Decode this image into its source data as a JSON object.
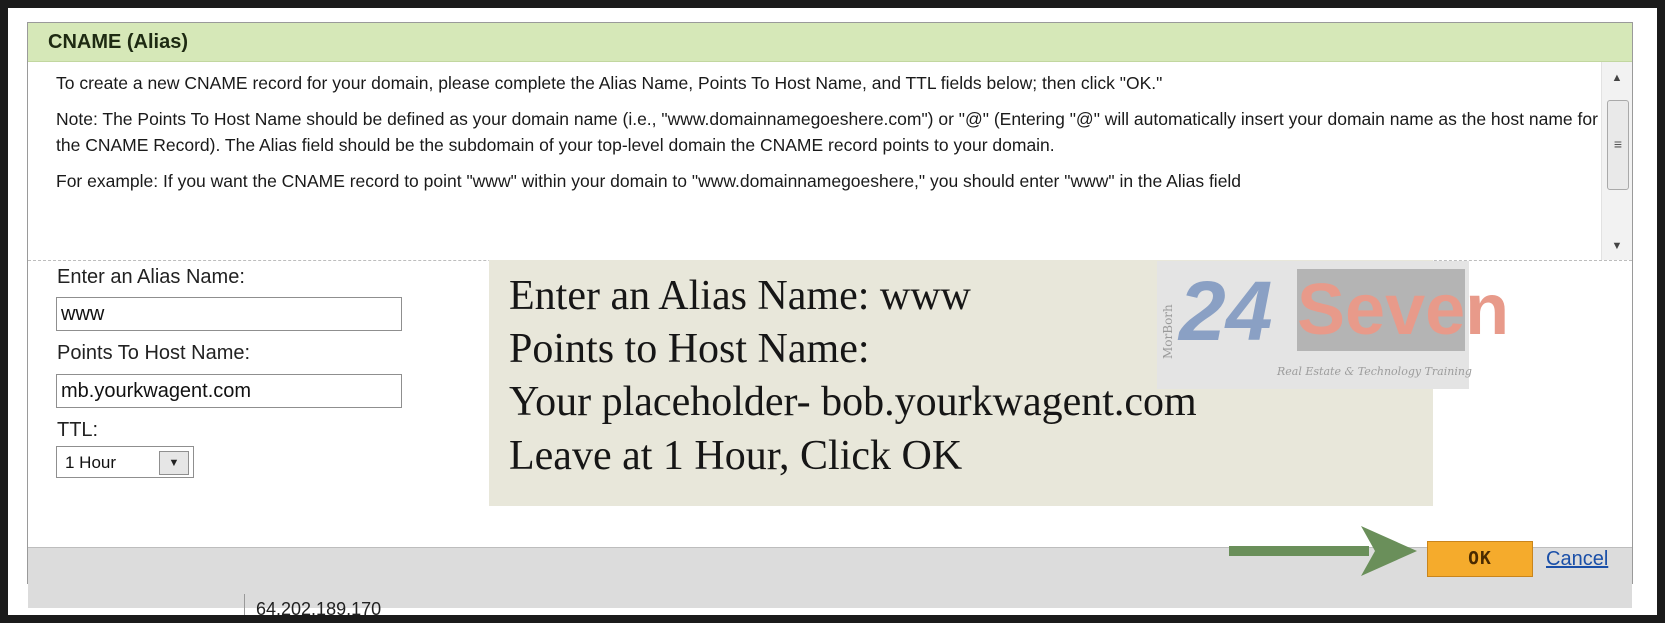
{
  "dialog": {
    "title": "CNAME (Alias)",
    "instructions": [
      "To create a new CNAME record for your domain, please complete the Alias Name, Points To Host Name, and TTL fields below; then click \"OK.\"",
      "Note: The Points To Host Name should be defined as your domain name (i.e., \"www.domainnamegoeshere.com\") or \"@\" (Entering \"@\" will automatically insert your domain name as the host name for the CNAME Record). The Alias field should be the subdomain of your top-level domain the CNAME record points to your domain.",
      "For example: If you want the CNAME record to point \"www\" within your domain to \"www.domainnamegoeshere,\" you should enter \"www\" in the Alias field"
    ],
    "form": {
      "alias_label": "Enter an Alias Name:",
      "alias_value": "www",
      "host_label": "Points To Host Name:",
      "host_value": "mb.yourkwagent.com",
      "ttl_label": "TTL:",
      "ttl_value": "1 Hour"
    },
    "ok_label": "OK",
    "cancel_label": "Cancel"
  },
  "overlay": {
    "lines": [
      "Enter an Alias Name: www",
      "Points to Host Name:",
      "Your placeholder- bob.yourkwagent.com",
      "Leave at 1 Hour, Click OK"
    ]
  },
  "logo": {
    "side_text": "MorBorh",
    "number": "24",
    "word": "Seven",
    "tagline": "Real Estate & Technology Training"
  },
  "background": {
    "ip_address": "64.202.189.170"
  },
  "colors": {
    "header_bg": "#d6e8b8",
    "ok_button": "#f5ab2c",
    "arrow": "#6a8f5a",
    "overlay_bg": "#e8e7da"
  }
}
